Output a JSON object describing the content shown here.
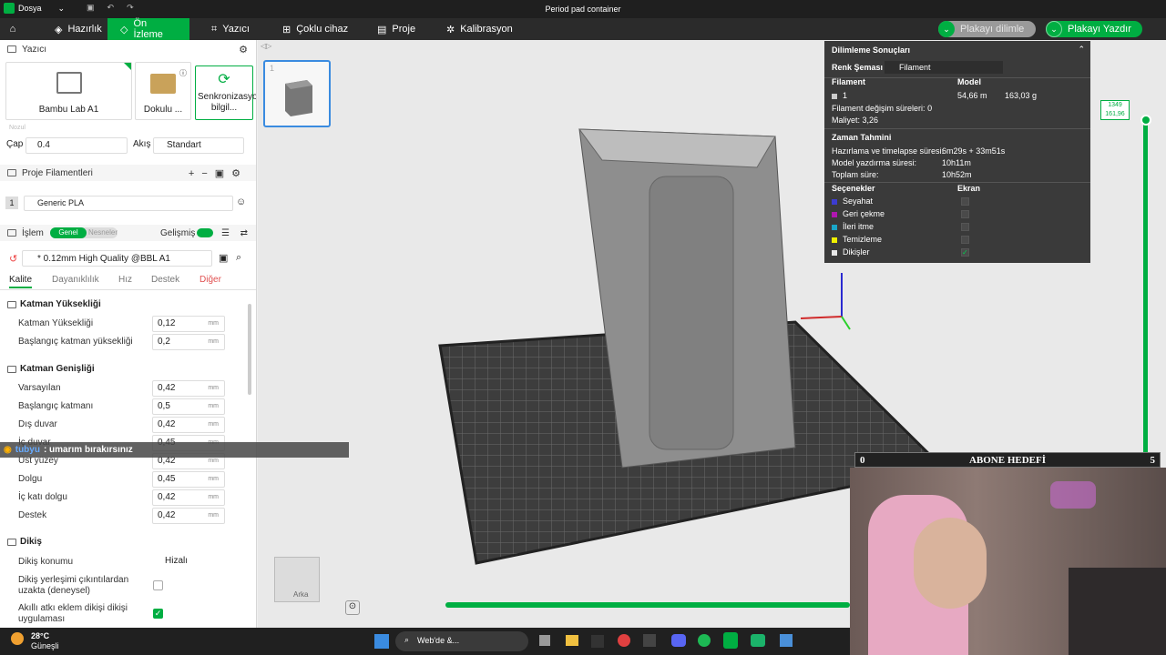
{
  "titlebar": {
    "menu_label": "Dosya",
    "title": "Period pad container"
  },
  "nav": {
    "tabs": [
      {
        "label": "Hazırlık"
      },
      {
        "label": "Ön İzleme"
      },
      {
        "label": "Yazıcı"
      },
      {
        "label": "Çoklu cihaz"
      },
      {
        "label": "Proje"
      },
      {
        "label": "Kalibrasyon"
      }
    ],
    "slice_button": "Plakayı dilimle",
    "print_button": "Plakayı Yazdır"
  },
  "printer": {
    "section_title": "Yazıcı",
    "printer_name": "Bambu Lab A1",
    "plate_name": "Dokulu ...",
    "sync_button": "Senkronizasyon bilgil...",
    "nozzle_hint": "Nozul",
    "diameter_label": "Çap",
    "diameter_value": "0.4",
    "flow_label": "Akış",
    "flow_value": "Standart"
  },
  "filaments": {
    "section_title": "Proje Filamentleri",
    "items": [
      {
        "index": "1",
        "name": "Generic PLA"
      }
    ]
  },
  "process": {
    "section_title": "İşlem",
    "toggle_general": "Genel",
    "toggle_objects": "Nesneler",
    "advanced_label": "Gelişmiş",
    "profile": "* 0.12mm High Quality @BBL A1",
    "tabs": [
      {
        "label": "Kalite"
      },
      {
        "label": "Dayanıklılık"
      },
      {
        "label": "Hız"
      },
      {
        "label": "Destek"
      },
      {
        "label": "Diğer"
      }
    ]
  },
  "quality": {
    "layer_height_group": "Katman Yüksekliği",
    "layer_height": {
      "label": "Katman Yüksekliği",
      "value": "0,12",
      "unit": "mm"
    },
    "initial_layer_height": {
      "label": "Başlangıç katman yüksekliği",
      "value": "0,2",
      "unit": "mm"
    },
    "line_width_group": "Katman Genişliği",
    "line_widths": [
      {
        "label": "Varsayılan",
        "value": "0,42",
        "unit": "mm"
      },
      {
        "label": "Başlangıç katmanı",
        "value": "0,5",
        "unit": "mm"
      },
      {
        "label": "Dış duvar",
        "value": "0,42",
        "unit": "mm"
      },
      {
        "label": "İç duvar",
        "value": "0,45",
        "unit": "mm"
      },
      {
        "label": "Üst yüzey",
        "value": "0,42",
        "unit": "mm"
      },
      {
        "label": "Dolgu",
        "value": "0,45",
        "unit": "mm"
      },
      {
        "label": "İç katı dolgu",
        "value": "0,42",
        "unit": "mm"
      },
      {
        "label": "Destek",
        "value": "0,42",
        "unit": "mm"
      }
    ],
    "seam_group": "Dikiş",
    "seam_position": {
      "label": "Dikiş konumu",
      "value": "Hizalı"
    },
    "seam_gap": {
      "label": "Dikiş yerleşimi çıkıntılardan uzakta (deneysel)",
      "checked": false
    },
    "smart_scarf": {
      "label": "Akıllı atkı eklem dikişi dikişi uygulaması",
      "checked": true
    }
  },
  "slice_results": {
    "title": "Dilimleme Sonuçları",
    "color_scheme_label": "Renk Şeması",
    "color_scheme_value": "Filament",
    "col_filament": "Filament",
    "col_model": "Model",
    "filament_row": {
      "index": "1",
      "length": "54,66 m",
      "weight": "163,03 g"
    },
    "change_time_label": "Filament değişim süreleri:",
    "change_time_value": "0",
    "cost_label": "Maliyet:",
    "cost_value": "3,26",
    "time_title": "Zaman Tahmini",
    "prep_label": "Hazırlama ve timelapse süresi:",
    "prep_value": "6m29s + 33m51s",
    "model_time_label": "Model yazdırma süresi:",
    "model_time_value": "10h11m",
    "total_label": "Toplam süre:",
    "total_value": "10h52m",
    "options_label": "Seçenekler",
    "display_label": "Ekran",
    "options": [
      {
        "label": "Seyahat",
        "color": "#3c3cd0",
        "checked": false
      },
      {
        "label": "Geri çekme",
        "color": "#b016b0",
        "checked": false
      },
      {
        "label": "İleri itme",
        "color": "#1aa6c8",
        "checked": false
      },
      {
        "label": "Temizleme",
        "color": "#f0f000",
        "checked": false
      },
      {
        "label": "Dikişler",
        "color": "#e8e8e8",
        "checked": true
      }
    ]
  },
  "layer_slider": {
    "top_value": "1349",
    "top_height": "161,96"
  },
  "plate": {
    "thumb_index": "1"
  },
  "view_cube": {
    "label": "Arka"
  },
  "chat": {
    "user": "tubyu",
    "message": ": umarım bırakırsınız"
  },
  "goal_bar": {
    "left": "0",
    "label": "ABONE HEDEFİ",
    "right": "5"
  },
  "taskbar": {
    "weather_temp": "28°C",
    "weather_desc": "Güneşli",
    "search": "Web'de &..."
  }
}
